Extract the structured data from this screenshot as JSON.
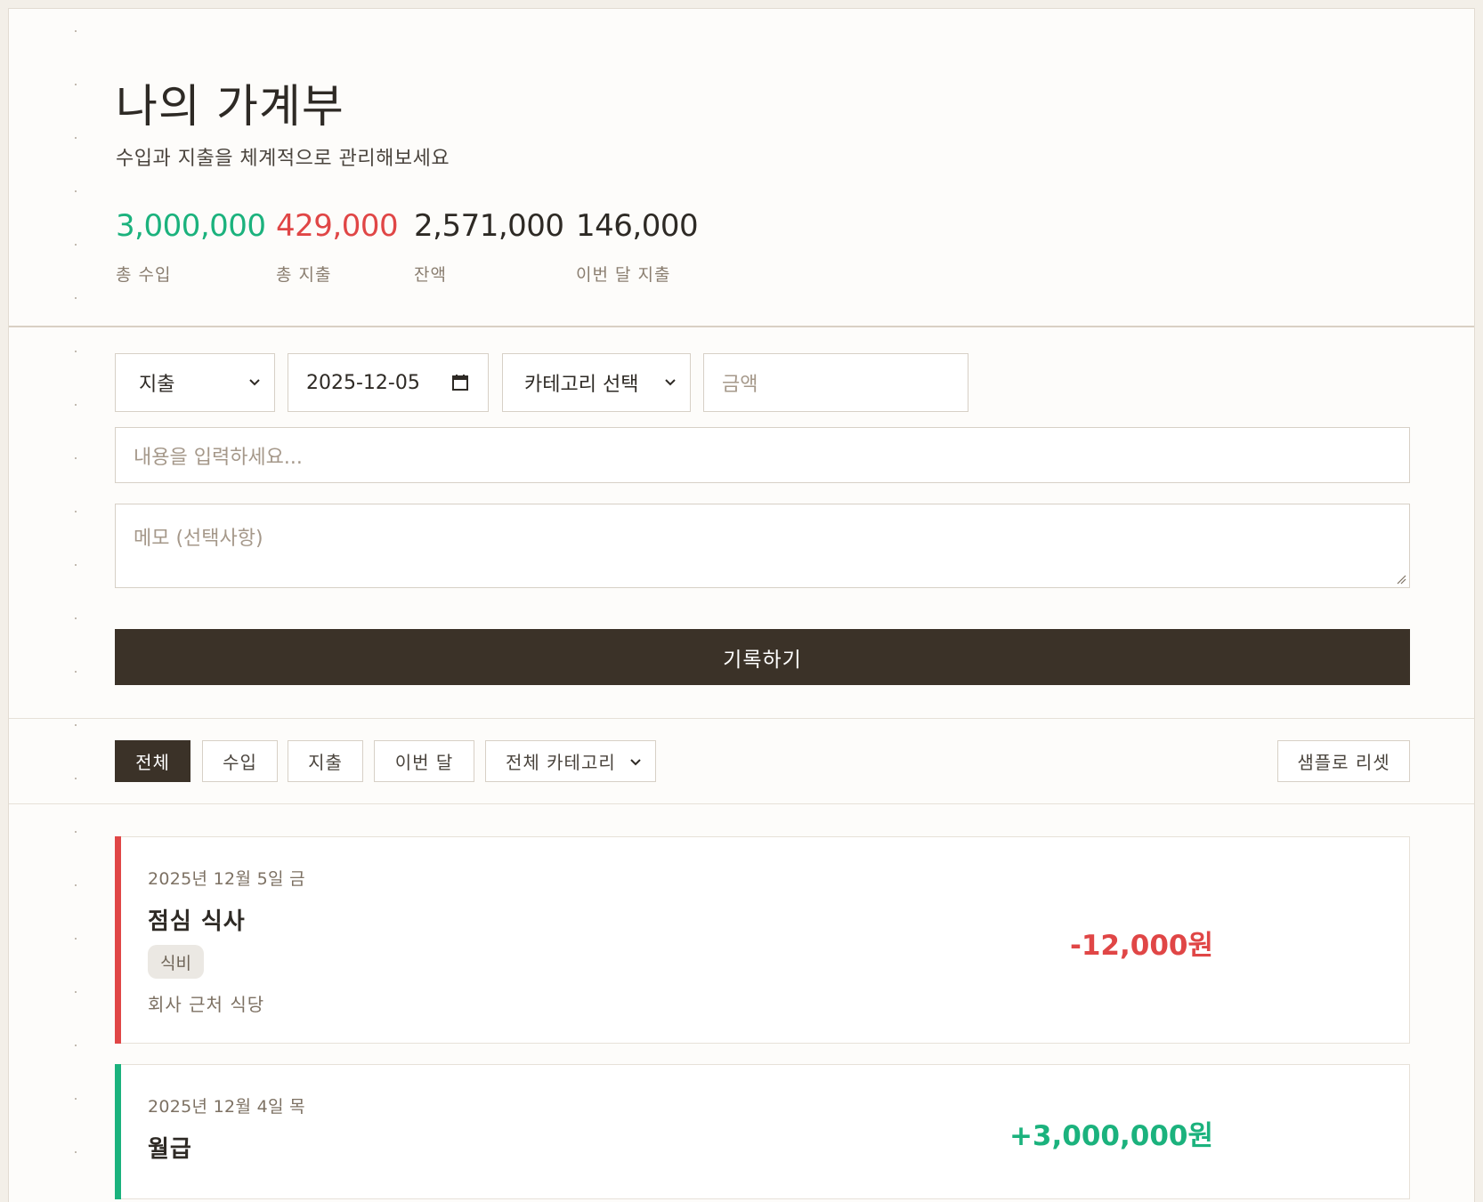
{
  "header": {
    "title": "나의 가계부",
    "subtitle": "수입과 지출을 체계적으로 관리해보세요",
    "stats": [
      {
        "value": "3,000,000",
        "label": "총 수입",
        "color": "#1bb27d"
      },
      {
        "value": "429,000",
        "label": "총 지출",
        "color": "#e04646"
      },
      {
        "value": "2,571,000",
        "label": "잔액",
        "color": "#2e2a25"
      },
      {
        "value": "146,000",
        "label": "이번 달 지출",
        "color": "#2e2a25"
      }
    ]
  },
  "form": {
    "type_value": "지출",
    "date_value": "2025-12-05",
    "category_value": "카테고리 선택",
    "amount_placeholder": "금액",
    "content_placeholder": "내용을 입력하세요...",
    "memo_placeholder": "메모 (선택사항)",
    "submit_label": "기록하기"
  },
  "filters": {
    "all": "전체",
    "income": "수입",
    "expense": "지출",
    "this_month": "이번 달",
    "category_value": "전체 카테고리",
    "reset": "샘플로 리셋"
  },
  "entries": [
    {
      "date": "2025년 12월 5일 금",
      "title": "점심 식사",
      "category": "식비",
      "memo": "회사 근처 식당",
      "amount": "-12,000원",
      "color": "#e04646"
    },
    {
      "date": "2025년 12월 4일 목",
      "title": "월급",
      "amount": "+3,000,000원",
      "color": "#1bb27d"
    }
  ],
  "colors": {
    "income": "#1bb27d",
    "expense": "#e04646",
    "dark": "#3b3228"
  }
}
